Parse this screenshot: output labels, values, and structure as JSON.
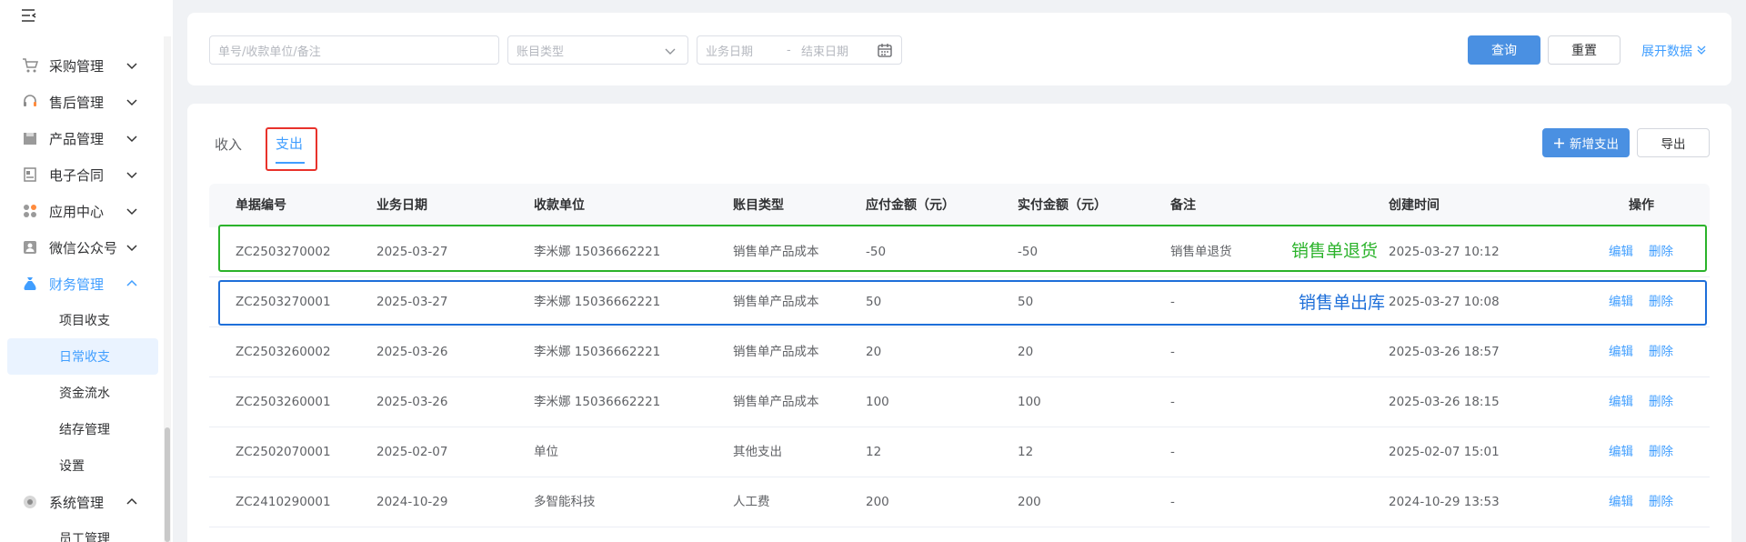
{
  "sidebar": {
    "menu_toggle_icon": "menu-fold-icon",
    "items": [
      {
        "label": "采购管理",
        "icon": "cart-icon"
      },
      {
        "label": "售后管理",
        "icon": "headset-icon"
      },
      {
        "label": "产品管理",
        "icon": "box-icon"
      },
      {
        "label": "电子合同",
        "icon": "contract-icon"
      },
      {
        "label": "应用中心",
        "icon": "apps-icon"
      },
      {
        "label": "微信公众号",
        "icon": "wechat-user-icon"
      },
      {
        "label": "财务管理",
        "icon": "money-bag-icon"
      },
      {
        "label": "系统管理",
        "icon": "settings-icon"
      }
    ],
    "finance_sub": [
      "项目收支",
      "日常收支",
      "资金流水",
      "结存管理",
      "设置"
    ],
    "system_sub": [
      "员工管理"
    ]
  },
  "filters": {
    "search_placeholder": "单号/收款单位/备注",
    "type_placeholder": "账目类型",
    "start_placeholder": "业务日期",
    "date_sep": "-",
    "end_placeholder": "结束日期",
    "query_label": "查询",
    "reset_label": "重置",
    "expand_label": "展开数据"
  },
  "tabs": {
    "income": "收入",
    "expense": "支出"
  },
  "actions": {
    "add_label": "新增支出",
    "export_label": "导出"
  },
  "table": {
    "headers": [
      "单据编号",
      "业务日期",
      "收款单位",
      "账目类型",
      "应付金额（元）",
      "实付金额（元）",
      "备注",
      "创建时间",
      "操作"
    ],
    "rows": [
      {
        "id": "ZC2503270002",
        "date": "2025-03-27",
        "payee": "李米娜 15036662221",
        "type": "销售单产品成本",
        "due": "-50",
        "paid": "-50",
        "remark": "销售单退货",
        "created": "2025-03-27 10:12",
        "edit": "编辑",
        "del": "删除"
      },
      {
        "id": "ZC2503270001",
        "date": "2025-03-27",
        "payee": "李米娜 15036662221",
        "type": "销售单产品成本",
        "due": "50",
        "paid": "50",
        "remark": "-",
        "created": "2025-03-27 10:08",
        "edit": "编辑",
        "del": "删除"
      },
      {
        "id": "ZC2503260002",
        "date": "2025-03-26",
        "payee": "李米娜 15036662221",
        "type": "销售单产品成本",
        "due": "20",
        "paid": "20",
        "remark": "-",
        "created": "2025-03-26 18:57",
        "edit": "编辑",
        "del": "删除"
      },
      {
        "id": "ZC2503260001",
        "date": "2025-03-26",
        "payee": "李米娜 15036662221",
        "type": "销售单产品成本",
        "due": "100",
        "paid": "100",
        "remark": "-",
        "created": "2025-03-26 18:15",
        "edit": "编辑",
        "del": "删除"
      },
      {
        "id": "ZC2502070001",
        "date": "2025-02-07",
        "payee": "单位",
        "type": "其他支出",
        "due": "12",
        "paid": "12",
        "remark": "-",
        "created": "2025-02-07 15:01",
        "edit": "编辑",
        "del": "删除"
      },
      {
        "id": "ZC2410290001",
        "date": "2024-10-29",
        "payee": "多智能科技",
        "type": "人工费",
        "due": "200",
        "paid": "200",
        "remark": "-",
        "created": "2024-10-29 13:53",
        "edit": "编辑",
        "del": "删除"
      }
    ]
  },
  "annotations": {
    "return_note": "销售单退货",
    "out_note": "销售单出库",
    "green": "#2bb32b",
    "blue": "#1e6fd9",
    "red": "#e8322b"
  },
  "colors": {
    "accent": "#409eff",
    "primary_button": "#4a90e2"
  }
}
